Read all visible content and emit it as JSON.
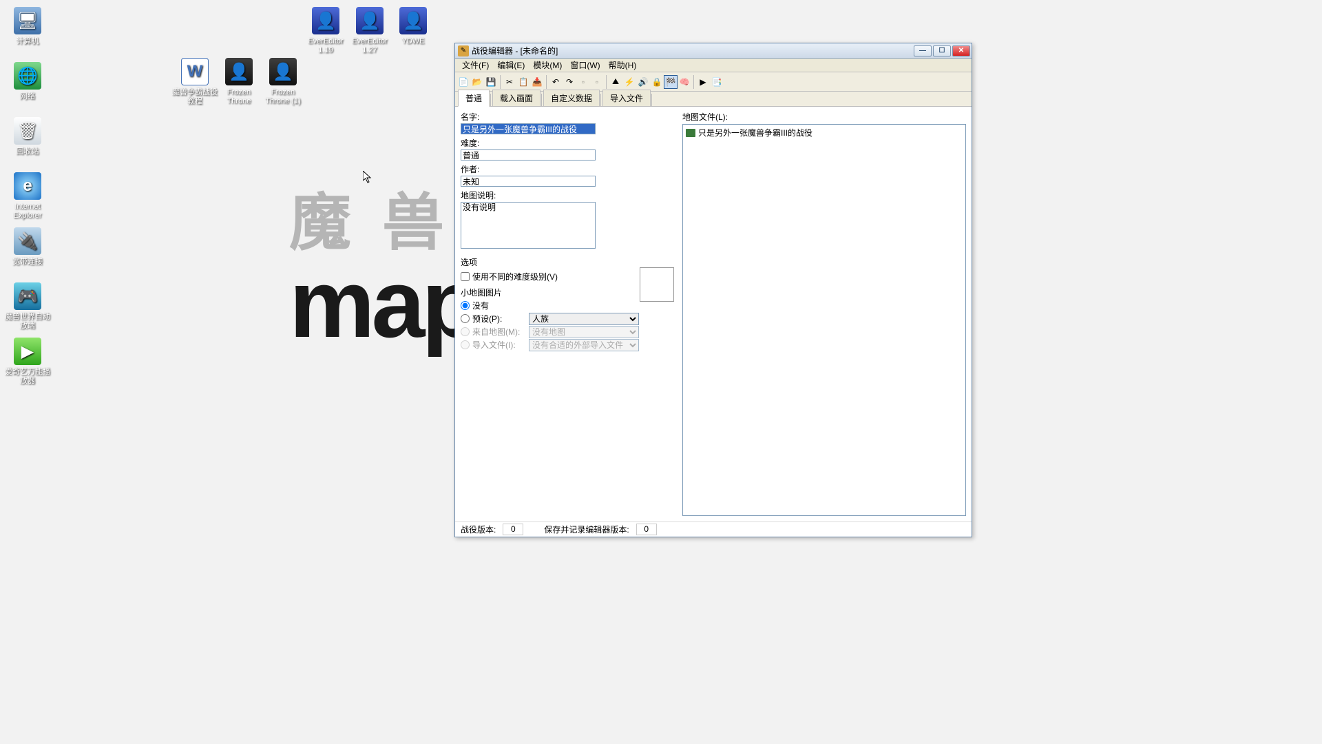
{
  "desktop_icons": {
    "computer": "计算机",
    "network": "网络",
    "recycle": "回收站",
    "ie": "Internet Explorer",
    "broadband": "宽带连接",
    "game_launch": "魔兽世界自动放端",
    "iqiyi": "爱奇艺万能播放器",
    "ee119": "EverEditor 1.19",
    "ee227": "EverEditor 1.27",
    "ydwe": "YDWE",
    "tutorial": "魔兽争霸战役教程",
    "ft1": "Frozen Throne",
    "ft2": "Frozen Throne (1)"
  },
  "wallpaper": {
    "line1": "魔 兽 争",
    "line2": "map"
  },
  "window": {
    "title": "战役编辑器 - [未命名的]",
    "menus": {
      "file": "文件(F)",
      "edit": "编辑(E)",
      "modules": "模块(M)",
      "window": "窗口(W)",
      "help": "帮助(H)"
    },
    "tabs": {
      "general": "普通",
      "load": "载入画面",
      "custom": "自定义数据",
      "import": "导入文件"
    },
    "labels": {
      "name": "名字:",
      "difficulty": "难度:",
      "author": "作者:",
      "map_desc": "地图说明:",
      "options": "选项",
      "var_difficulty": "使用不同的难度级别(V)",
      "minimap": "小地图图片",
      "none": "没有",
      "preset": "预设(P):",
      "from_map": "来自地图(M):",
      "import_file": "导入文件(I):",
      "map_files": "地图文件(L):"
    },
    "values": {
      "name": "只是另外一张魔兽争霸III的战役",
      "difficulty": "普通",
      "author": "未知",
      "desc": "没有说明",
      "preset": "人族",
      "from_map": "没有地图",
      "import_file": "没有合适的外部导入文件"
    },
    "list_item": "只是另外一张魔兽争霸III的战役",
    "status": {
      "version_label": "战役版本:",
      "version_value": "0",
      "saved_label": "保存并记录编辑器版本:",
      "saved_value": "0"
    }
  }
}
